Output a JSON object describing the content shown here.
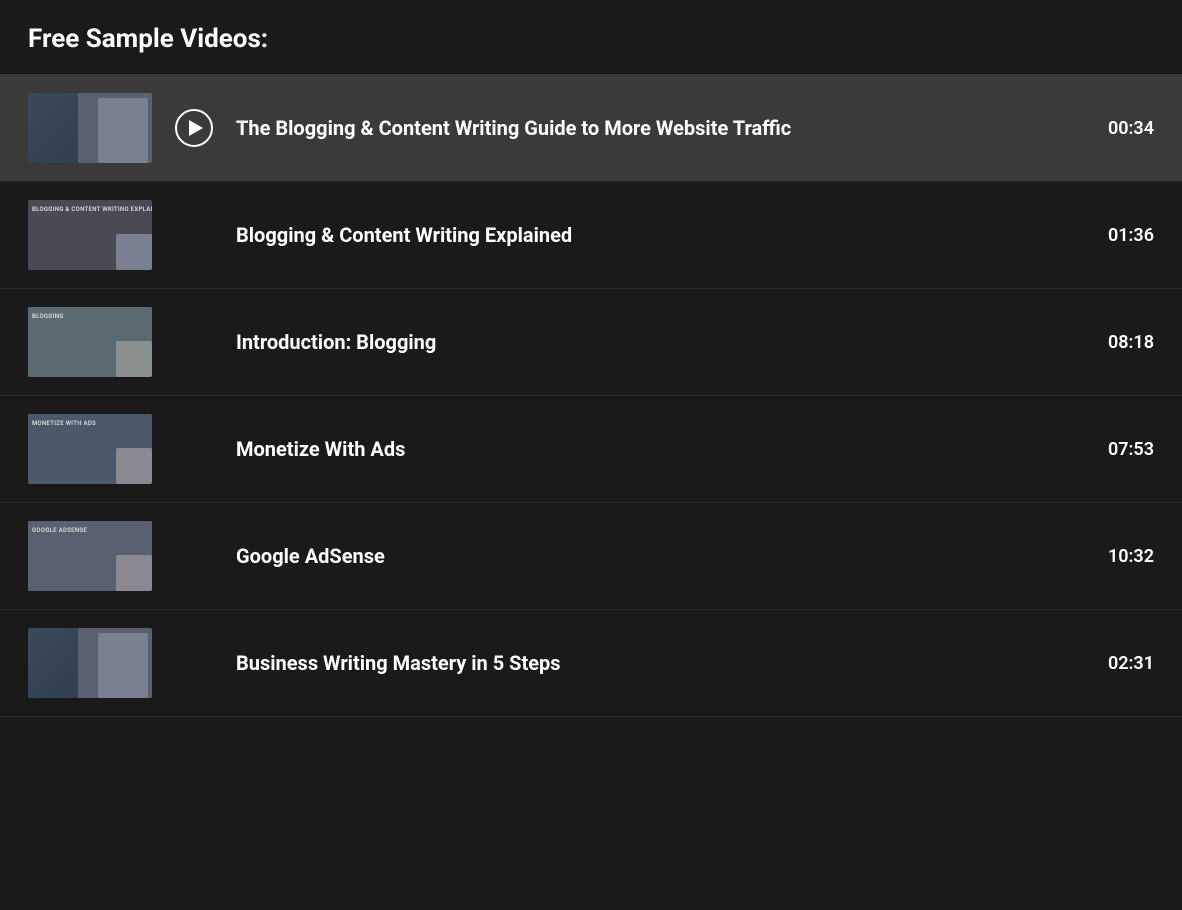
{
  "page": {
    "title": "Free Sample Videos:"
  },
  "videos": [
    {
      "id": "video-1",
      "title": "The Blogging & Content Writing Guide to More Website Traffic",
      "duration": "00:34",
      "thumbnail_type": "person",
      "thumbnail_label": "",
      "active": true
    },
    {
      "id": "video-2",
      "title": "Blogging & Content Writing Explained",
      "duration": "01:36",
      "thumbnail_type": "screen",
      "thumbnail_label": "BLOGGING & CONTENT WRITING EXPLAINED",
      "active": false
    },
    {
      "id": "video-3",
      "title": "Introduction: Blogging",
      "duration": "08:18",
      "thumbnail_type": "screen",
      "thumbnail_label": "BLOGGING",
      "active": false
    },
    {
      "id": "video-4",
      "title": "Monetize With Ads",
      "duration": "07:53",
      "thumbnail_type": "screen",
      "thumbnail_label": "MONETIZE WITH ADS",
      "active": false
    },
    {
      "id": "video-5",
      "title": "Google AdSense",
      "duration": "10:32",
      "thumbnail_type": "screen",
      "thumbnail_label": "GOOGLE ADSENSE",
      "active": false
    },
    {
      "id": "video-6",
      "title": "Business Writing Mastery in 5 Steps",
      "duration": "02:31",
      "thumbnail_type": "person",
      "thumbnail_label": "",
      "active": false
    }
  ]
}
